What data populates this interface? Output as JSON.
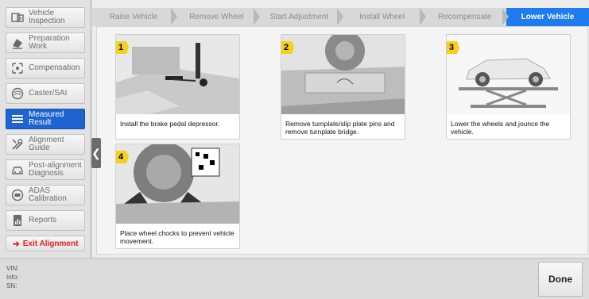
{
  "sidebar": {
    "items": [
      {
        "label": "Vehicle Inspection",
        "icon": "vehicle-inspection-icon"
      },
      {
        "label": "Preparation Work",
        "icon": "preparation-icon"
      },
      {
        "label": "Compensation",
        "icon": "compensation-icon"
      },
      {
        "label": "Caster/SAI",
        "icon": "caster-icon"
      },
      {
        "label": "Measured Result",
        "icon": "measured-result-icon"
      },
      {
        "label": "Alignment Guide",
        "icon": "tools-icon"
      },
      {
        "label": "Post-alignment Diagnosis",
        "icon": "car-diagnosis-icon"
      },
      {
        "label": "ADAS Calibration",
        "icon": "adas-icon"
      },
      {
        "label": "Reports",
        "icon": "reports-icon"
      }
    ],
    "exit_label": "Exit Alignment",
    "active_index": 4
  },
  "steps": [
    "Raise Vehicle",
    "Remove Wheel",
    "Start Adjustment",
    "Install Wheel",
    "Recompensate",
    "Lower Vehicle"
  ],
  "active_step": "Lower Vehicle",
  "cards": [
    {
      "num": "1",
      "text": "Install the brake pedal depressor."
    },
    {
      "num": "2",
      "text": "Remove turnplate/slip plate pins and remove turnplate bridge."
    },
    {
      "num": "3",
      "text": "Lower the wheels and jounce the vehicle."
    },
    {
      "num": "4",
      "text": "Place wheel chocks to prevent vehicle movement."
    }
  ],
  "footer": {
    "vin_label": "VIN:",
    "info_label": "Info:",
    "sn_label": "SN:",
    "done_label": "Done"
  },
  "colors": {
    "accent": "#1e7cf0",
    "sidebar_active": "#1e63d0",
    "exit_red": "#e0201c",
    "step_badge": "#f6d11b"
  }
}
